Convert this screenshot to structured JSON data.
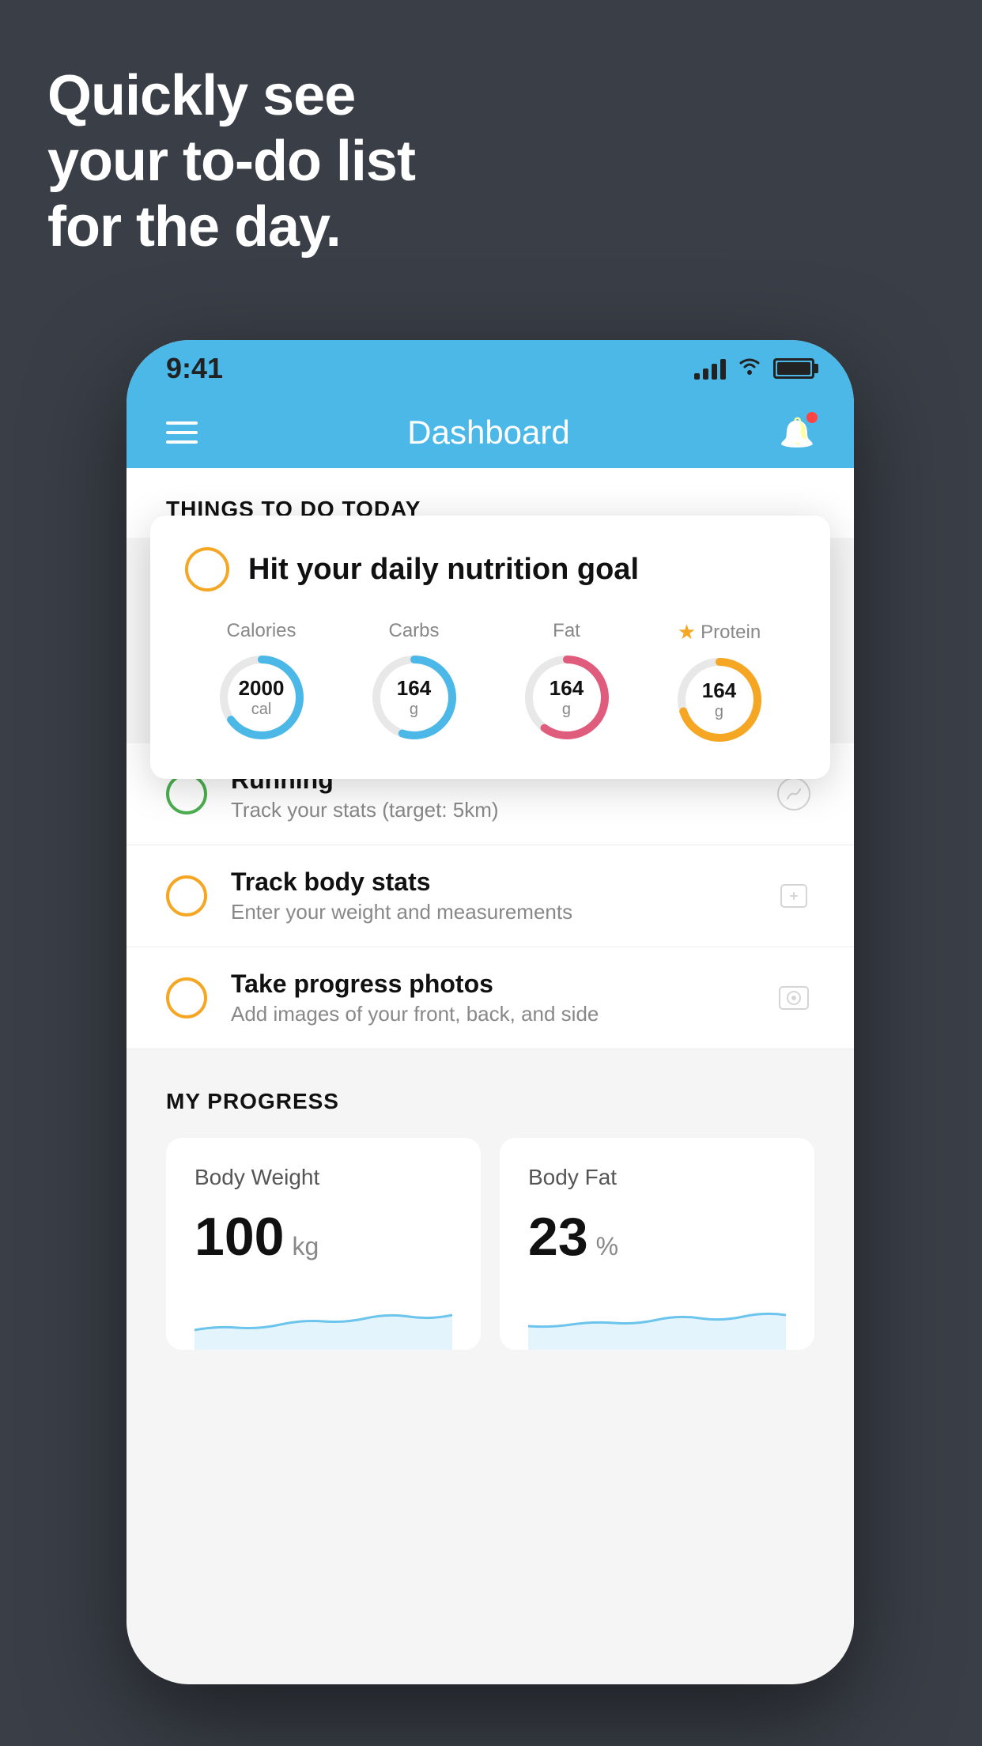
{
  "background": {
    "color": "#3a3f47"
  },
  "hero": {
    "line1": "Quickly see",
    "line2": "your to-do list",
    "line3": "for the day."
  },
  "phone": {
    "status_bar": {
      "time": "9:41",
      "signal_bars": [
        8,
        14,
        20,
        26
      ],
      "has_wifi": true,
      "has_battery": true
    },
    "nav": {
      "title": "Dashboard",
      "has_menu": true,
      "has_bell": true
    },
    "things_today": {
      "section_title": "THINGS TO DO TODAY"
    },
    "floating_card": {
      "title": "Hit your daily nutrition goal",
      "nutrition": [
        {
          "label": "Calories",
          "value": "2000",
          "unit": "cal",
          "color": "#4bb8e8",
          "pct": 65
        },
        {
          "label": "Carbs",
          "value": "164",
          "unit": "g",
          "color": "#4bb8e8",
          "pct": 55
        },
        {
          "label": "Fat",
          "value": "164",
          "unit": "g",
          "color": "#e05c7d",
          "pct": 60
        },
        {
          "label": "Protein",
          "value": "164",
          "unit": "g",
          "color": "#f5a623",
          "pct": 70,
          "star": true
        }
      ]
    },
    "todo_items": [
      {
        "title": "Running",
        "subtitle": "Track your stats (target: 5km)",
        "circle_color": "green",
        "icon": "👟"
      },
      {
        "title": "Track body stats",
        "subtitle": "Enter your weight and measurements",
        "circle_color": "yellow",
        "icon": "⚖️"
      },
      {
        "title": "Take progress photos",
        "subtitle": "Add images of your front, back, and side",
        "circle_color": "yellow",
        "icon": "🖼️"
      }
    ],
    "progress": {
      "section_title": "MY PROGRESS",
      "cards": [
        {
          "title": "Body Weight",
          "value": "100",
          "unit": "kg"
        },
        {
          "title": "Body Fat",
          "value": "23",
          "unit": "%"
        }
      ]
    }
  }
}
